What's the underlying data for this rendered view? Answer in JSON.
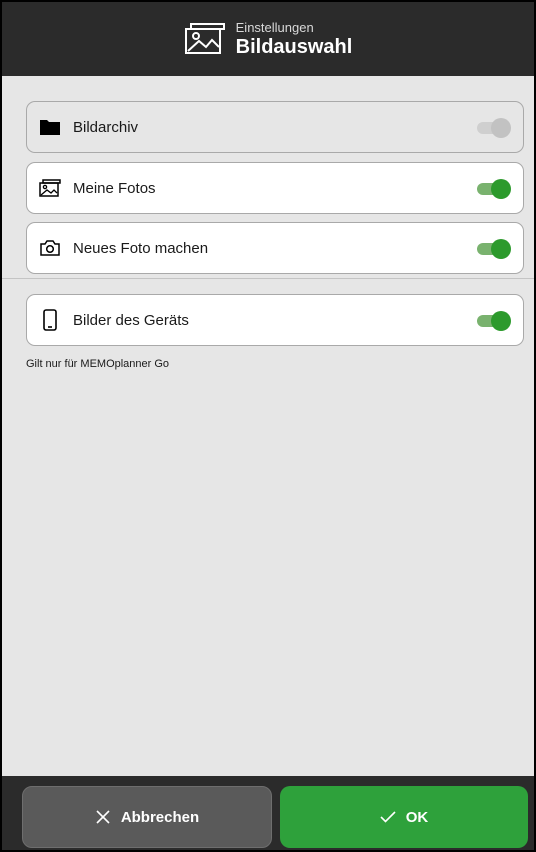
{
  "header": {
    "subtitle": "Einstellungen",
    "title": "Bildauswahl",
    "icon": "image-gallery-icon"
  },
  "options": [
    {
      "label": "Bildarchiv",
      "icon": "folder-icon",
      "enabled": false
    },
    {
      "label": "Meine Fotos",
      "icon": "photos-icon",
      "enabled": true
    },
    {
      "label": "Neues Foto machen",
      "icon": "camera-icon",
      "enabled": true
    },
    {
      "label": "Bilder des Geräts",
      "icon": "phone-icon",
      "enabled": true
    }
  ],
  "note": "Gilt nur für MEMOplanner Go",
  "footer": {
    "cancel_label": "Abbrechen",
    "ok_label": "OK"
  },
  "colors": {
    "header_bg": "#2b2b2b",
    "toggle_on": "#2c9a2c",
    "ok_button": "#2ea13b",
    "cancel_button": "#5a5a5a"
  }
}
